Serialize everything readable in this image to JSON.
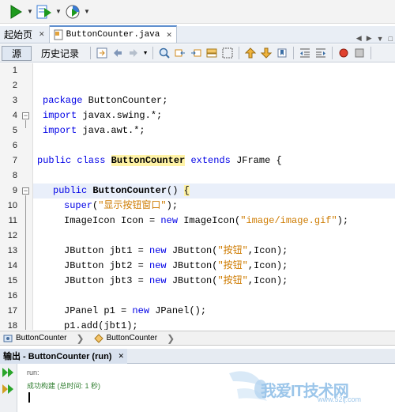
{
  "toolbar": {
    "icons": [
      "run-icon",
      "dropdown-icon",
      "debug-icon",
      "dropdown-icon",
      "profile-icon",
      "dropdown-icon"
    ],
    "colors": {
      "run": "#1e9a1e",
      "debug": "#3a7bd5"
    }
  },
  "tabs": [
    {
      "label": "起始页",
      "active": false
    },
    {
      "label": "ButtonCounter.java",
      "active": true
    }
  ],
  "editor_toolbar": {
    "source_label": "源",
    "history_label": "历史记录"
  },
  "code": {
    "line_numbers": [
      "1",
      "2",
      "3",
      "4",
      "5",
      "6",
      "7",
      "8",
      "9",
      "10",
      "11",
      "12",
      "13",
      "14",
      "15",
      "16",
      "17",
      "18"
    ],
    "l3_kw": "package",
    "l3_rest": " ButtonCounter;",
    "l4_kw": "import",
    "l4_rest": " javax.swing.*;",
    "l5_kw": "import",
    "l5_rest": " java.awt.*;",
    "l7_kw1": "public class",
    "l7_name": "ButtonCounter",
    "l7_kw2": "extends",
    "l7_rest": " JFrame {",
    "l9_kw": "public",
    "l9_name": "ButtonCounter",
    "l9_paren": "() ",
    "l9_brace": "{",
    "l10_kw": "super",
    "l10_open": "(",
    "l10_str": "\"显示按钮窗口\"",
    "l10_close": ");",
    "l11_a": "ImageIcon Icon = ",
    "l11_kw": "new",
    "l11_b": " ImageIcon(",
    "l11_str": "\"image/image.gif\"",
    "l11_c": ");",
    "l13_a": "JButton jbt1 = ",
    "l13_kw": "new",
    "l13_b": " JButton(",
    "l13_str": "\"按钮\"",
    "l13_c": ",Icon);",
    "l14_a": "JButton jbt2 = ",
    "l14_kw": "new",
    "l14_b": " JButton(",
    "l14_str": "\"按钮\"",
    "l14_c": ",Icon);",
    "l15_a": "JButton jbt3 = ",
    "l15_kw": "new",
    "l15_b": " JButton(",
    "l15_str": "\"按钮\"",
    "l15_c": ",Icon);",
    "l17_a": "JPanel p1 = ",
    "l17_kw": "new",
    "l17_b": " JPanel();",
    "l18": "p1.add(jbt1);"
  },
  "breadcrumb": {
    "items": [
      "ButtonCounter",
      "ButtonCounter"
    ]
  },
  "output": {
    "tab_label": "输出 - ButtonCounter (run)",
    "lines": [
      "run:",
      "成功构建 (总时间: 1 秒)"
    ]
  },
  "watermark": {
    "text": "我爱IT技术网",
    "url": "www.52ij.com"
  }
}
